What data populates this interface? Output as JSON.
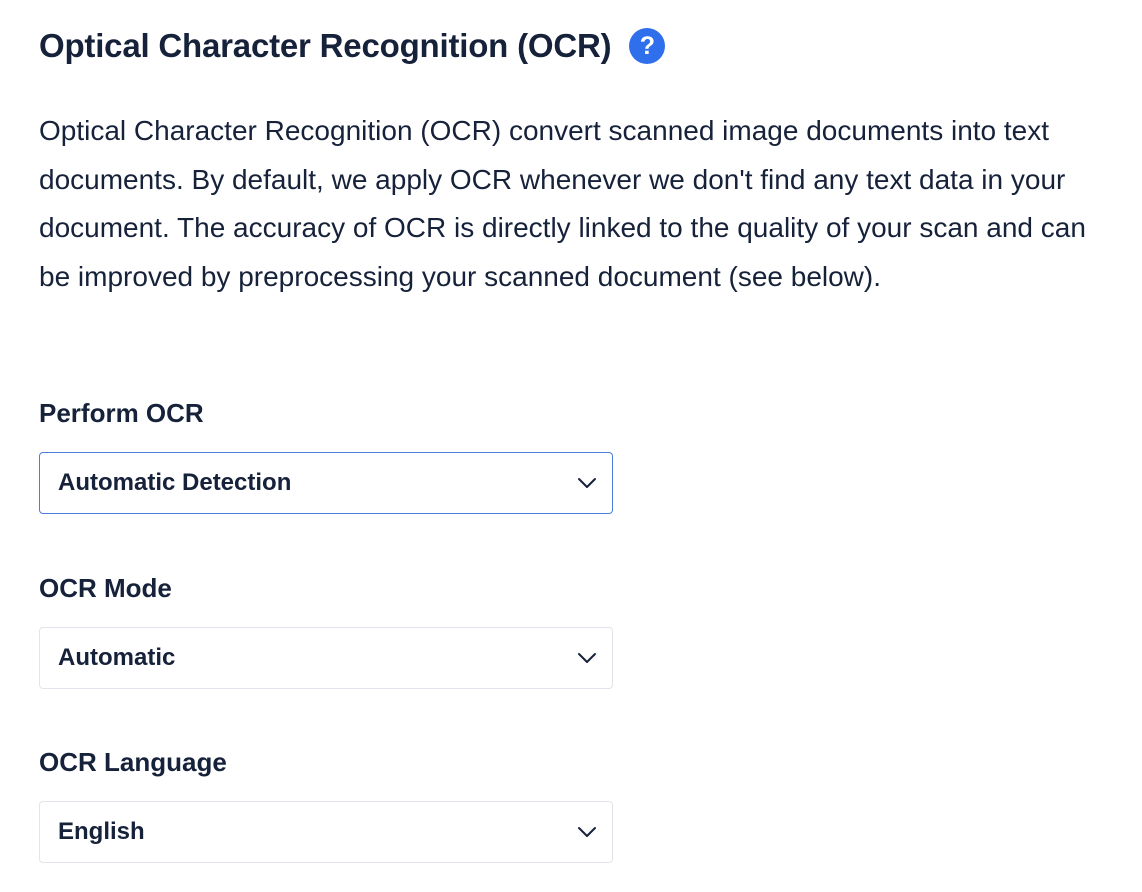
{
  "section": {
    "title": "Optical Character Recognition (OCR)",
    "help_icon": "question-circle-icon",
    "help_icon_glyph": "?",
    "description": "Optical Character Recognition (OCR) convert scanned image documents into text documents. By default, we apply OCR whenever we don't find any text data in your document. The accuracy of OCR is directly linked to the quality of your scan and can be improved by preprocessing your scanned document (see below)."
  },
  "fields": {
    "perform_ocr": {
      "label": "Perform OCR",
      "value": "Automatic Detection"
    },
    "ocr_mode": {
      "label": "OCR Mode",
      "value": "Automatic"
    },
    "ocr_language": {
      "label": "OCR Language",
      "value": "English"
    }
  },
  "colors": {
    "text": "#16213a",
    "accent": "#2f6fec",
    "focus_border": "#4a7fdc",
    "border": "#e1e4ea"
  }
}
